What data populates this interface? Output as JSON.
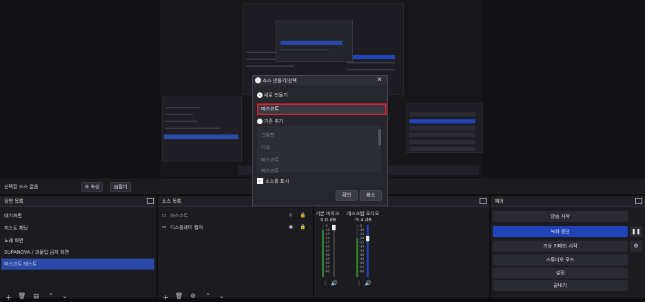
{
  "dialog": {
    "title": "소스 만들기/선택",
    "create_new_label": "새로 만들기",
    "name_value": "마스코트",
    "add_existing_label": "기존 추가",
    "existing_items": [
      "그림판",
      "디코",
      "마스코트",
      "마스코트"
    ],
    "show_source_label": "소스를 표시",
    "ok_label": "확인",
    "cancel_label": "취소",
    "close_glyph": "✕"
  },
  "source_bar": {
    "status": "선택된 소스 없음",
    "properties_label": "속성",
    "filters_label": "필터"
  },
  "scenes": {
    "title": "장면 목록",
    "items": [
      "대기화면",
      "저스트 채팅",
      "노래 화면",
      "SUPANOVA / 과몰입 금지 화면",
      "마스코트 테스트"
    ]
  },
  "sources": {
    "title": "소스 목록",
    "items": [
      "마스코트",
      "디스플레이 캡처"
    ]
  },
  "audio": {
    "mic_label": "기본 마이크",
    "desktop_label": "데스크탑 오디오",
    "mic_db": "0.0 dB",
    "desktop_db": "-5.4 dB",
    "ticks": [
      "-5",
      "-10",
      "-15",
      "-20",
      "-25",
      "-30",
      "-35",
      "-40",
      "-45",
      "-50",
      "-55",
      "-60"
    ]
  },
  "controls": {
    "title": "제어",
    "start_stream": "방송 시작",
    "stop_record": "녹화 중단",
    "virtual_cam": "가상 카메라 시작",
    "studio_mode": "스튜디오 모드",
    "settings": "설정",
    "exit": "끝내기"
  },
  "colors": {
    "accent_blue": "#2143b8",
    "highlight_red": "#e0202a"
  }
}
